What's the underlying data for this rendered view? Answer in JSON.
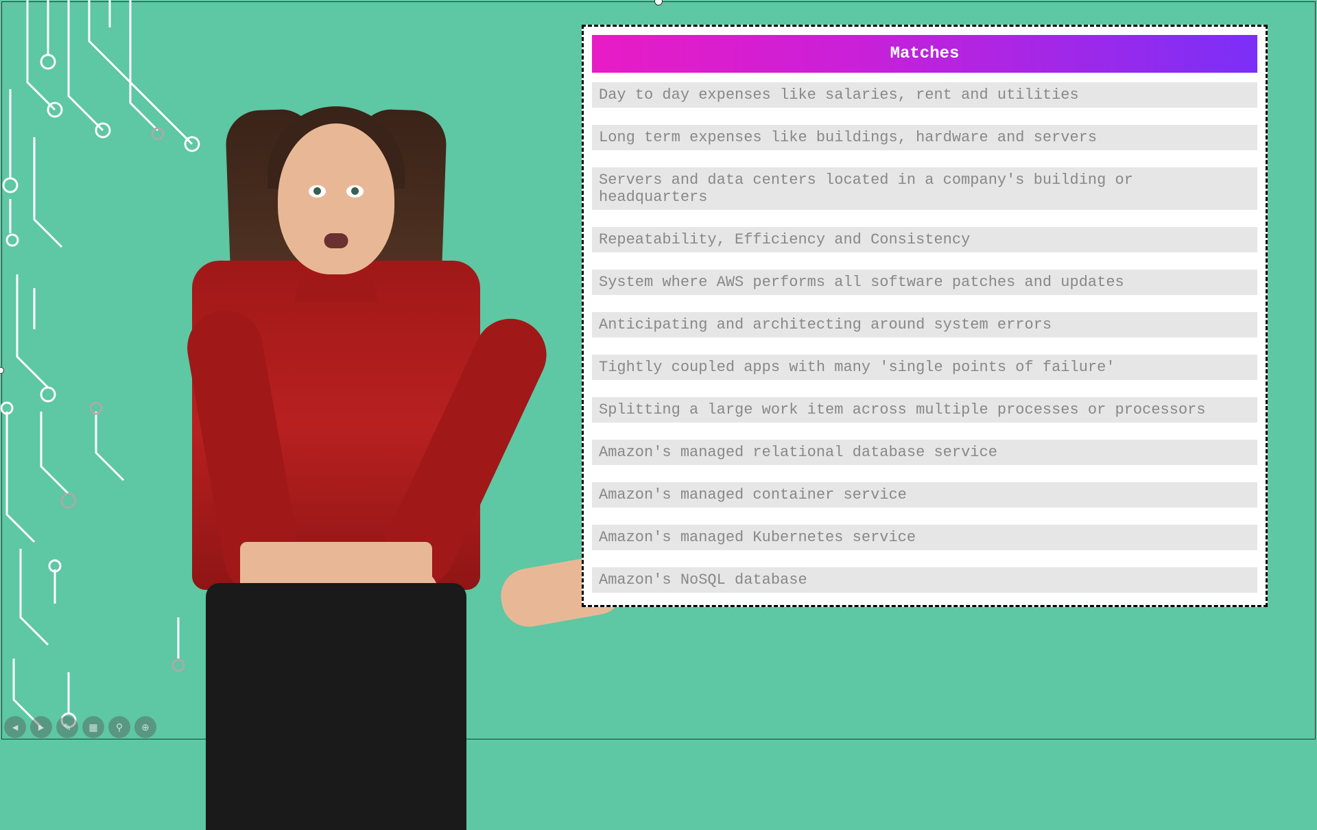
{
  "panel": {
    "header": "Matches",
    "items": [
      "Day to day expenses like salaries, rent and utilities",
      "Long term expenses like buildings, hardware and servers",
      "Servers and data centers located in a company's building or headquarters",
      "Repeatability, Efficiency and Consistency",
      "System where AWS performs all software patches and updates",
      "Anticipating and architecting around system errors",
      "Tightly coupled apps with many 'single points of failure'",
      "Splitting a large work item across multiple processes or processors",
      "Amazon's managed relational database service",
      "Amazon's managed container service",
      "Amazon's managed Kubernetes service",
      "Amazon's NoSQL database"
    ]
  },
  "toolbar": {
    "prev": "◄",
    "next": "►",
    "pen": "✎",
    "layout": "▦",
    "zoom": "⚲",
    "fit": "⊕"
  }
}
